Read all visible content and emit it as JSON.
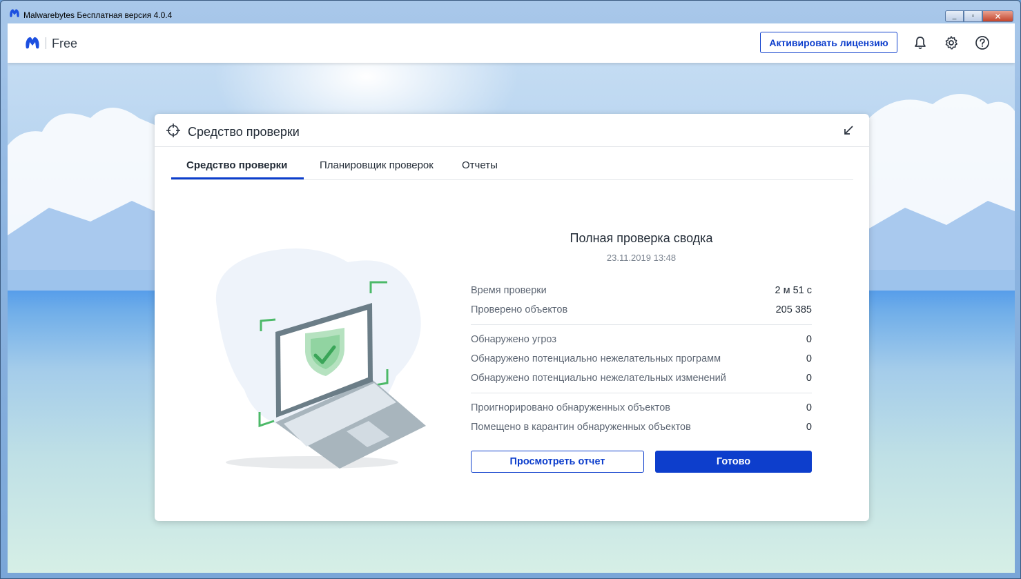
{
  "window": {
    "title": "Malwarebytes Бесплатная версия  4.0.4",
    "controls": [
      "_",
      "▫",
      "✕"
    ]
  },
  "header": {
    "edition": "Free",
    "activate_label": "Активировать лицензию",
    "icons": [
      "bell-icon",
      "gear-icon",
      "help-icon"
    ]
  },
  "card": {
    "title": "Средство проверки",
    "tabs": [
      "Средство проверки",
      "Планировщик проверок",
      "Отчеты"
    ],
    "summary": {
      "title": "Полная проверка сводка",
      "date": "23.11.2019 13:48",
      "group1": [
        {
          "label": "Время проверки",
          "value": "2 м 51 с"
        },
        {
          "label": "Проверено объектов",
          "value": "205 385"
        }
      ],
      "group2": [
        {
          "label": "Обнаружено угроз",
          "value": "0"
        },
        {
          "label": "Обнаружено потенциально нежелательных программ",
          "value": "0"
        },
        {
          "label": "Обнаружено потенциально нежелательных изменений",
          "value": "0"
        }
      ],
      "group3": [
        {
          "label": "Проигнорировано обнаруженных объектов",
          "value": "0"
        },
        {
          "label": "Помещено в карантин обнаруженных объектов",
          "value": "0"
        }
      ]
    },
    "buttons": {
      "report": "Просмотреть отчет",
      "done": "Готово"
    }
  },
  "colors": {
    "accent": "#0d3ecc",
    "shield_green": "#4cb968"
  }
}
